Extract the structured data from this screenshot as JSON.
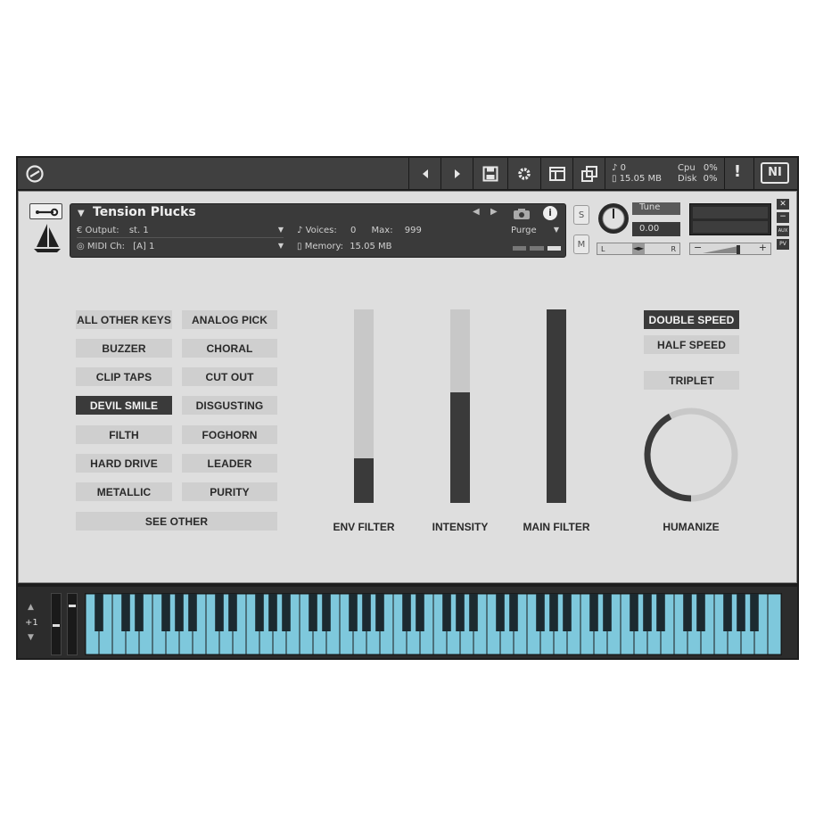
{
  "topbar": {
    "voices_count": "0",
    "memory": "15.05 MB",
    "cpu_label": "Cpu",
    "cpu_value": "0%",
    "disk_label": "Disk",
    "disk_value": "0%",
    "alert": "!",
    "logo": "NI"
  },
  "header": {
    "instrument_name": "Tension Plucks",
    "output_label": "Output:",
    "output_value": "st. 1",
    "voices_label": "Voices:",
    "voices_value": "0",
    "max_label": "Max:",
    "max_value": "999",
    "purge_label": "Purge",
    "midi_label": "MIDI Ch:",
    "midi_value": "[A]  1",
    "memory_label": "Memory:",
    "memory_value": "15.05 MB",
    "solo": "S",
    "mute": "M",
    "tune_label": "Tune",
    "tune_value": "0.00",
    "pan_left": "L",
    "pan_right": "R",
    "aux": "AUX",
    "pv": "PV"
  },
  "presets": {
    "left": [
      "ALL OTHER KEYS",
      "BUZZER",
      "CLIP TAPS",
      "DEVIL SMILE",
      "FILTH",
      "HARD DRIVE",
      "METALLIC"
    ],
    "right": [
      "ANALOG PICK",
      "CHORAL",
      "CUT OUT",
      "DISGUSTING",
      "FOGHORN",
      "LEADER",
      "PURITY"
    ],
    "see_other": "SEE OTHER",
    "active": "DEVIL SMILE"
  },
  "sliders": [
    {
      "label": "ENV FILTER",
      "level": 0.23
    },
    {
      "label": "INTENSITY",
      "level": 0.57
    },
    {
      "label": "MAIN FILTER",
      "level": 1.0
    }
  ],
  "speed": {
    "double": "DOUBLE SPEED",
    "half": "HALF SPEED",
    "triplet": "TRIPLET",
    "active": "DOUBLE SPEED"
  },
  "humanize": {
    "label": "HUMANIZE",
    "level": 0.42
  },
  "keyboard": {
    "octave": "+1"
  },
  "colors": {
    "accent": "#3a3a3a",
    "button": "#cfcfcf",
    "keys": "#7ec8dc",
    "panel": "#dedede"
  }
}
